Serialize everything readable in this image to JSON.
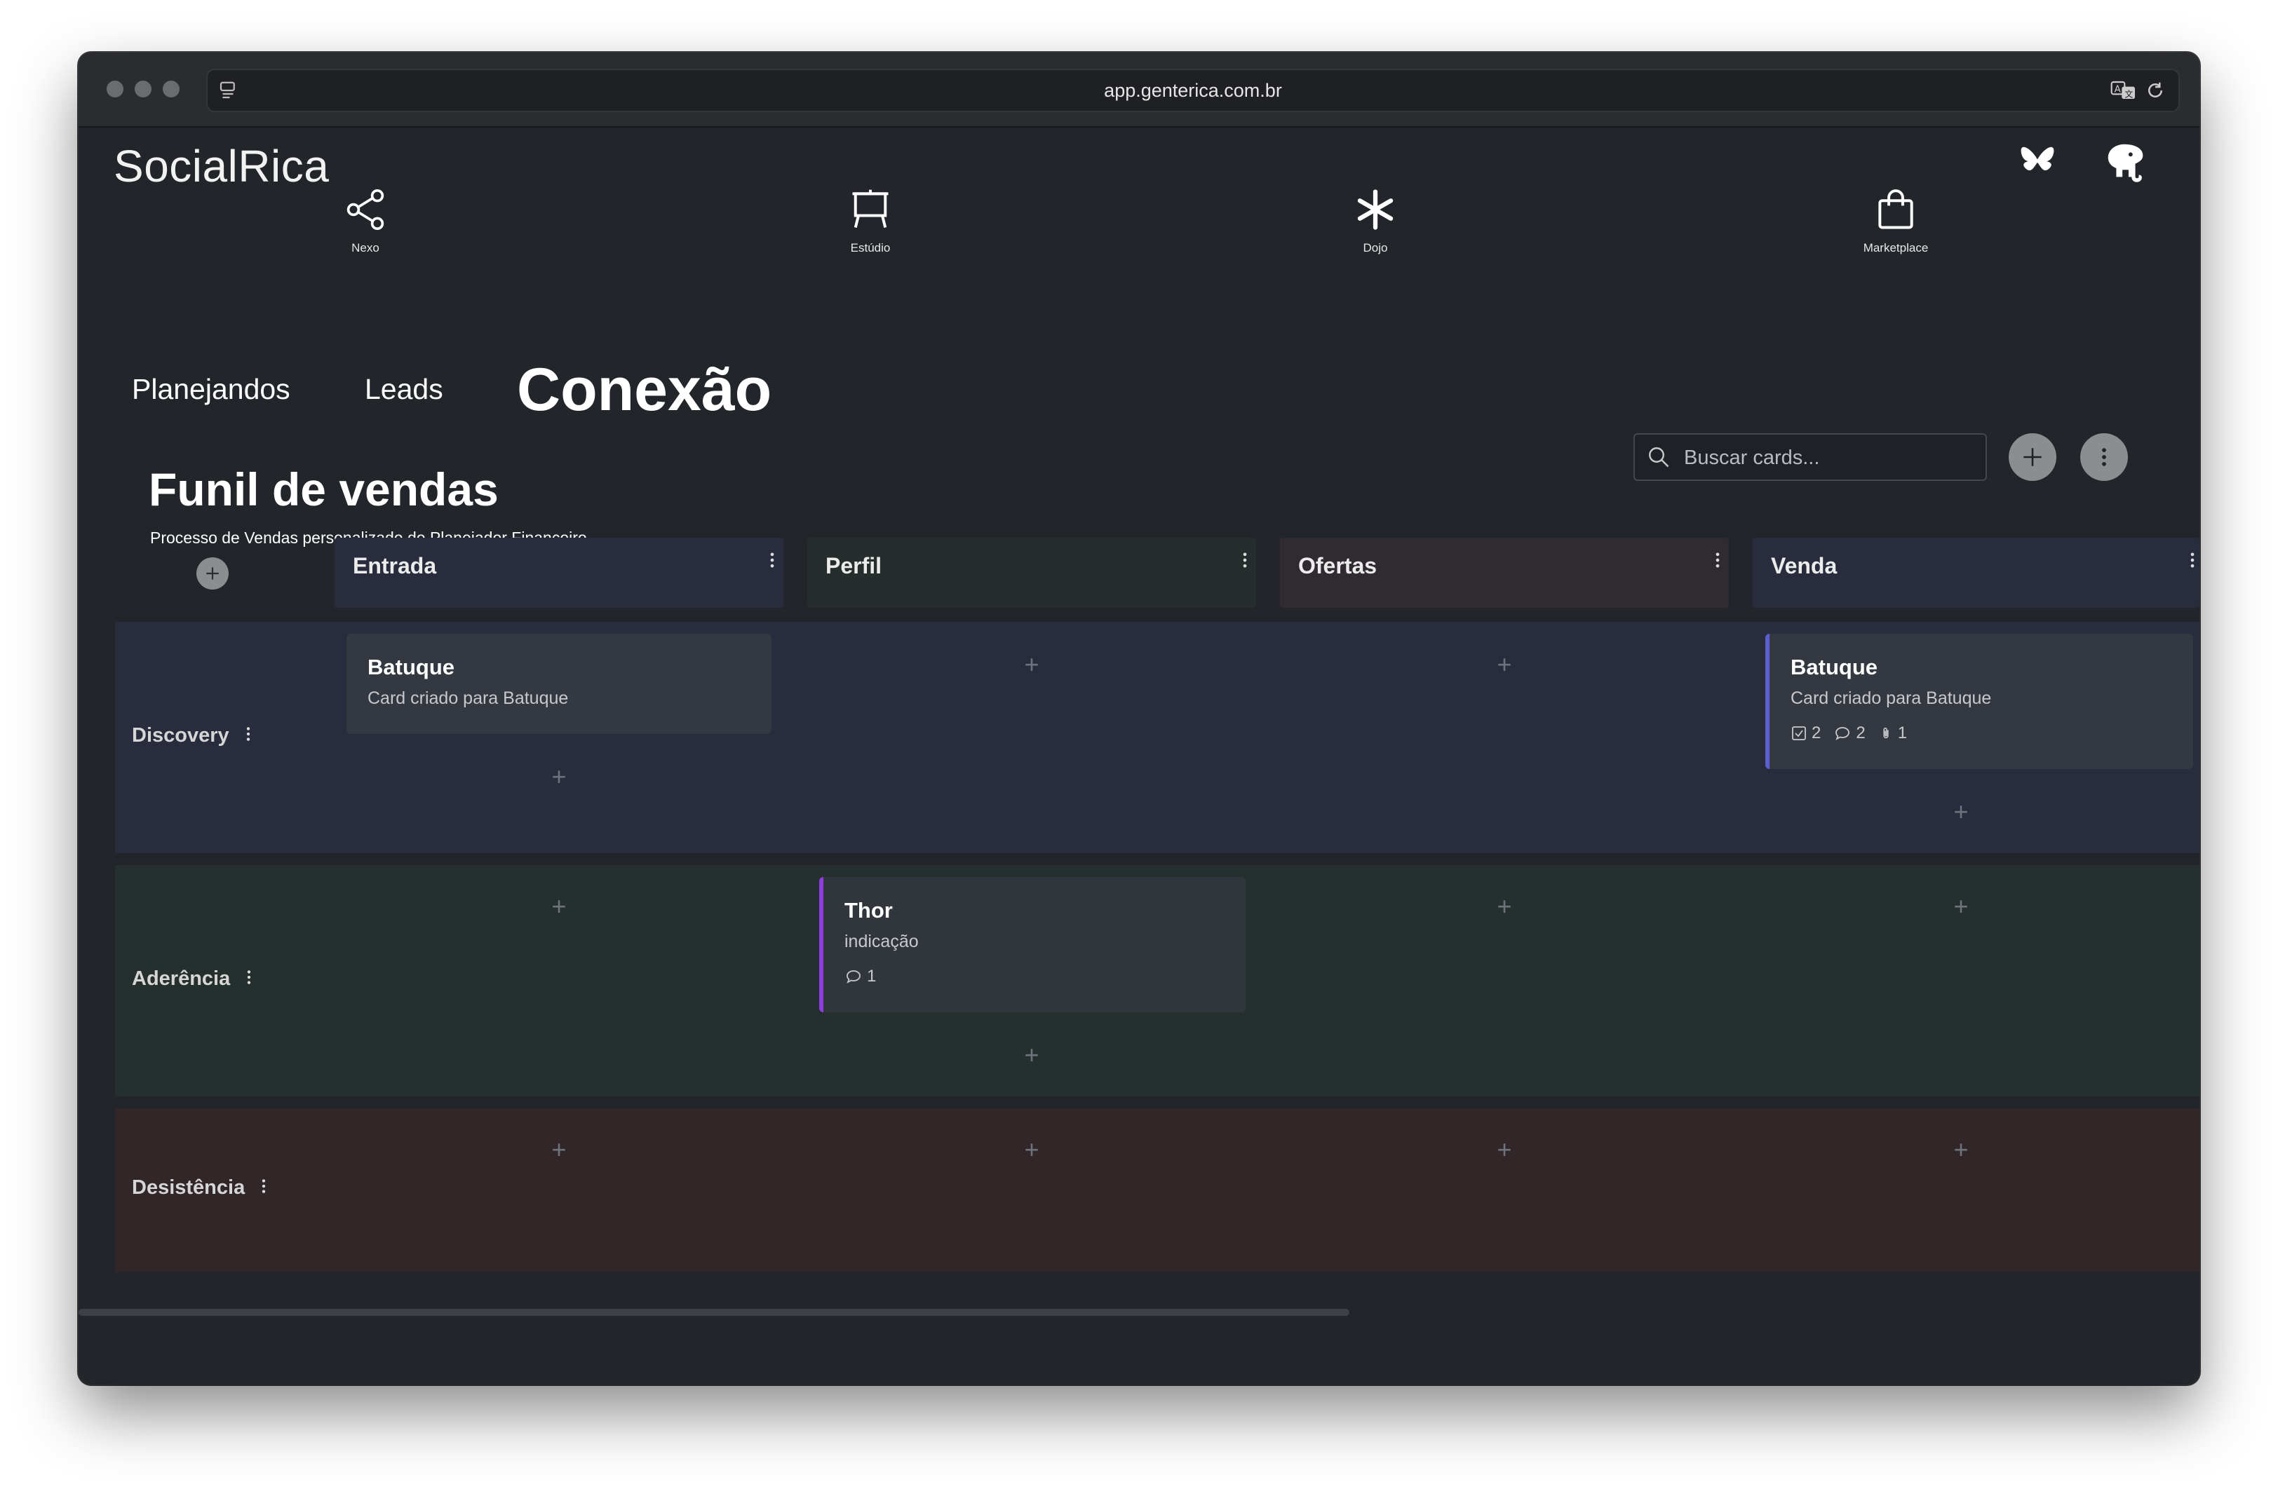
{
  "browser": {
    "url": "app.genterica.com.br"
  },
  "app": {
    "brand": "SocialRica"
  },
  "nav": [
    {
      "label": "Nexo",
      "icon": "share-nodes-icon"
    },
    {
      "label": "Estúdio",
      "icon": "easel-icon"
    },
    {
      "label": "Dojo",
      "icon": "asterisk-icon"
    },
    {
      "label": "Marketplace",
      "icon": "shopping-bag-icon"
    }
  ],
  "tabs": [
    {
      "label": "Planejandos",
      "active": false
    },
    {
      "label": "Leads",
      "active": false
    },
    {
      "label": "Conexão",
      "active": true
    }
  ],
  "board": {
    "title": "Funil de vendas",
    "subtitle": "Processo de Vendas personalizado do Planejador Financeiro",
    "search_placeholder": "Buscar cards...",
    "columns": [
      {
        "label": "Entrada",
        "color": "#282c3d"
      },
      {
        "label": "Perfil",
        "color": "#262e2d"
      },
      {
        "label": "Ofertas",
        "color": "#302a31"
      },
      {
        "label": "Venda",
        "color": "#282c3d"
      }
    ],
    "lanes": [
      {
        "label": "Discovery",
        "color": "#282c3d"
      },
      {
        "label": "Aderência",
        "color": "#25302e"
      },
      {
        "label": "Desistência",
        "color": "#312628"
      }
    ],
    "cards": [
      {
        "title": "Batuque",
        "subtitle": "Card criado para Batuque"
      },
      {
        "title": "Batuque",
        "subtitle": "Card criado para Batuque",
        "checks": "2",
        "comments": "2",
        "attachments": "1",
        "accent": "#5a5fd0"
      },
      {
        "title": "Thor",
        "subtitle": "indicação",
        "comments": "1",
        "accent": "#8f3de0"
      }
    ]
  },
  "colors": {
    "window_bg": "#22252a",
    "text": "#ffffff"
  }
}
